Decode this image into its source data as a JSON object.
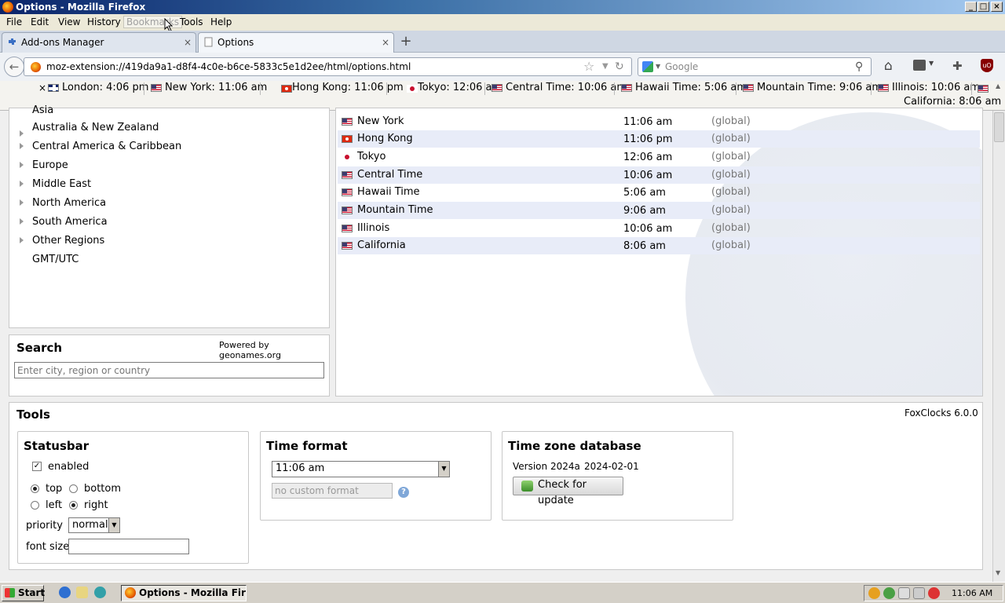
{
  "window": {
    "title": "Options - Mozilla Firefox",
    "controls": [
      "_",
      "□",
      "×"
    ]
  },
  "menu": [
    "File",
    "Edit",
    "View",
    "History",
    "Bookmarks",
    "Tools",
    "Help"
  ],
  "tabs": [
    {
      "label": "Add-ons Manager",
      "icon": "puzzle-icon"
    },
    {
      "label": "Options",
      "icon": "page-icon"
    }
  ],
  "nav": {
    "url": "moz-extension://419da9a1-d8f4-4c0e-b6ce-5833c5e1d2ee/html/options.html",
    "search_placeholder": "Google"
  },
  "clockbar": {
    "close": "×",
    "clocks": [
      {
        "flag": "uk",
        "text": "London: 4:06 pm"
      },
      {
        "flag": "us",
        "text": "New York: 11:06 am"
      },
      {
        "flag": "hk",
        "text": "Hong Kong: 11:06 pm"
      },
      {
        "flag": "jp",
        "text": "Tokyo: 12:06 am"
      },
      {
        "flag": "us",
        "text": "Central Time: 10:06 am"
      },
      {
        "flag": "us",
        "text": "Hawaii Time: 5:06 am"
      },
      {
        "flag": "us",
        "text": "Mountain Time: 9:06 am"
      },
      {
        "flag": "us",
        "text": "Illinois: 10:06 am"
      },
      {
        "flag": "us",
        "text": "California: 8:06 am"
      }
    ]
  },
  "regions": [
    {
      "label": "Asia",
      "expandable": true
    },
    {
      "label": "Australia & New Zealand",
      "expandable": true
    },
    {
      "label": "Central America & Caribbean",
      "expandable": true
    },
    {
      "label": "Europe",
      "expandable": true
    },
    {
      "label": "Middle East",
      "expandable": true
    },
    {
      "label": "North America",
      "expandable": true
    },
    {
      "label": "South America",
      "expandable": true
    },
    {
      "label": "Other Regions",
      "expandable": true
    },
    {
      "label": "GMT/UTC",
      "expandable": false
    }
  ],
  "search": {
    "title": "Search",
    "powered": "Powered by geonames.org",
    "placeholder": "Enter city, region or country"
  },
  "zones": [
    {
      "flag": "us",
      "name": "New York",
      "time": "11:06 am",
      "scope": "(global)"
    },
    {
      "flag": "hk",
      "name": "Hong Kong",
      "time": "11:06 pm",
      "scope": "(global)"
    },
    {
      "flag": "jp",
      "name": "Tokyo",
      "time": "12:06 am",
      "scope": "(global)"
    },
    {
      "flag": "us",
      "name": "Central Time",
      "time": "10:06 am",
      "scope": "(global)"
    },
    {
      "flag": "us",
      "name": "Hawaii Time",
      "time": "5:06 am",
      "scope": "(global)"
    },
    {
      "flag": "us",
      "name": "Mountain Time",
      "time": "9:06 am",
      "scope": "(global)"
    },
    {
      "flag": "us",
      "name": "Illinois",
      "time": "10:06 am",
      "scope": "(global)"
    },
    {
      "flag": "us",
      "name": "California",
      "time": "8:06 am",
      "scope": "(global)"
    }
  ],
  "tools": {
    "title": "Tools",
    "version": "FoxClocks 6.0.0",
    "statusbar": {
      "title": "Statusbar",
      "enabled_label": "enabled",
      "enabled": true,
      "top": "top",
      "bottom": "bottom",
      "left": "left",
      "right": "right",
      "priority_label": "priority",
      "priority_value": "normal",
      "fontsize_label": "font size",
      "fontsize_value": ""
    },
    "timeformat": {
      "title": "Time format",
      "value": "11:06 am",
      "custom_placeholder": "no custom format"
    },
    "tzdb": {
      "title": "Time zone database",
      "version": "Version 2024a",
      "date": "2024-02-01",
      "update_label": "Check for update"
    }
  },
  "taskbar": {
    "start": "Start",
    "task": "Options - Mozilla Firef...",
    "clock": "11:06 AM"
  }
}
